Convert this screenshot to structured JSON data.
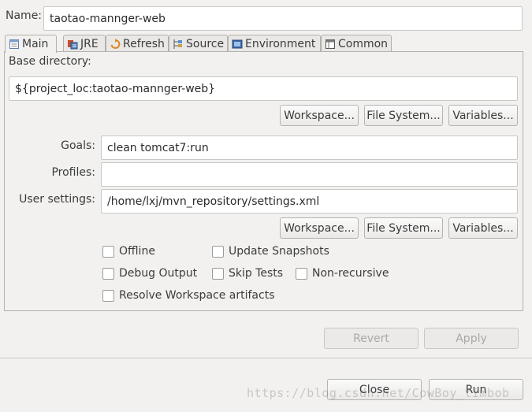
{
  "name_label": "Name:",
  "name_value": "taotao-mannger-web",
  "tabs": [
    {
      "label": "Main",
      "icon": "main-tab-icon"
    },
    {
      "label": "JRE",
      "icon": "jre-icon"
    },
    {
      "label": "Refresh",
      "icon": "refresh-icon"
    },
    {
      "label": "Source",
      "icon": "source-icon"
    },
    {
      "label": "Environment",
      "icon": "environment-icon"
    },
    {
      "label": "Common",
      "icon": "common-icon"
    }
  ],
  "base_directory": {
    "label": "Base directory:",
    "value": "${project_loc:taotao-mannger-web}"
  },
  "dir_buttons": {
    "workspace": "Workspace...",
    "file_system": "File System...",
    "variables": "Variables..."
  },
  "goals": {
    "label": "Goals:",
    "value": "clean tomcat7:run"
  },
  "profiles": {
    "label": "Profiles:",
    "value": ""
  },
  "user_settings": {
    "label": "User settings:",
    "value": "/home/lxj/mvn_repository/settings.xml"
  },
  "settings_buttons": {
    "workspace": "Workspace...",
    "file_system": "File System...",
    "variables": "Variables..."
  },
  "checkboxes": {
    "offline": "Offline",
    "update_snapshots": "Update Snapshots",
    "debug_output": "Debug Output",
    "skip_tests": "Skip Tests",
    "non_recursive": "Non-recursive",
    "resolve_workspace": "Resolve Workspace artifacts"
  },
  "actions": {
    "revert": "Revert",
    "apply": "Apply"
  },
  "dialog": {
    "close": "Close",
    "run": "Run"
  },
  "watermark": "https://blog.csdn.net/CowBoy_timbob"
}
